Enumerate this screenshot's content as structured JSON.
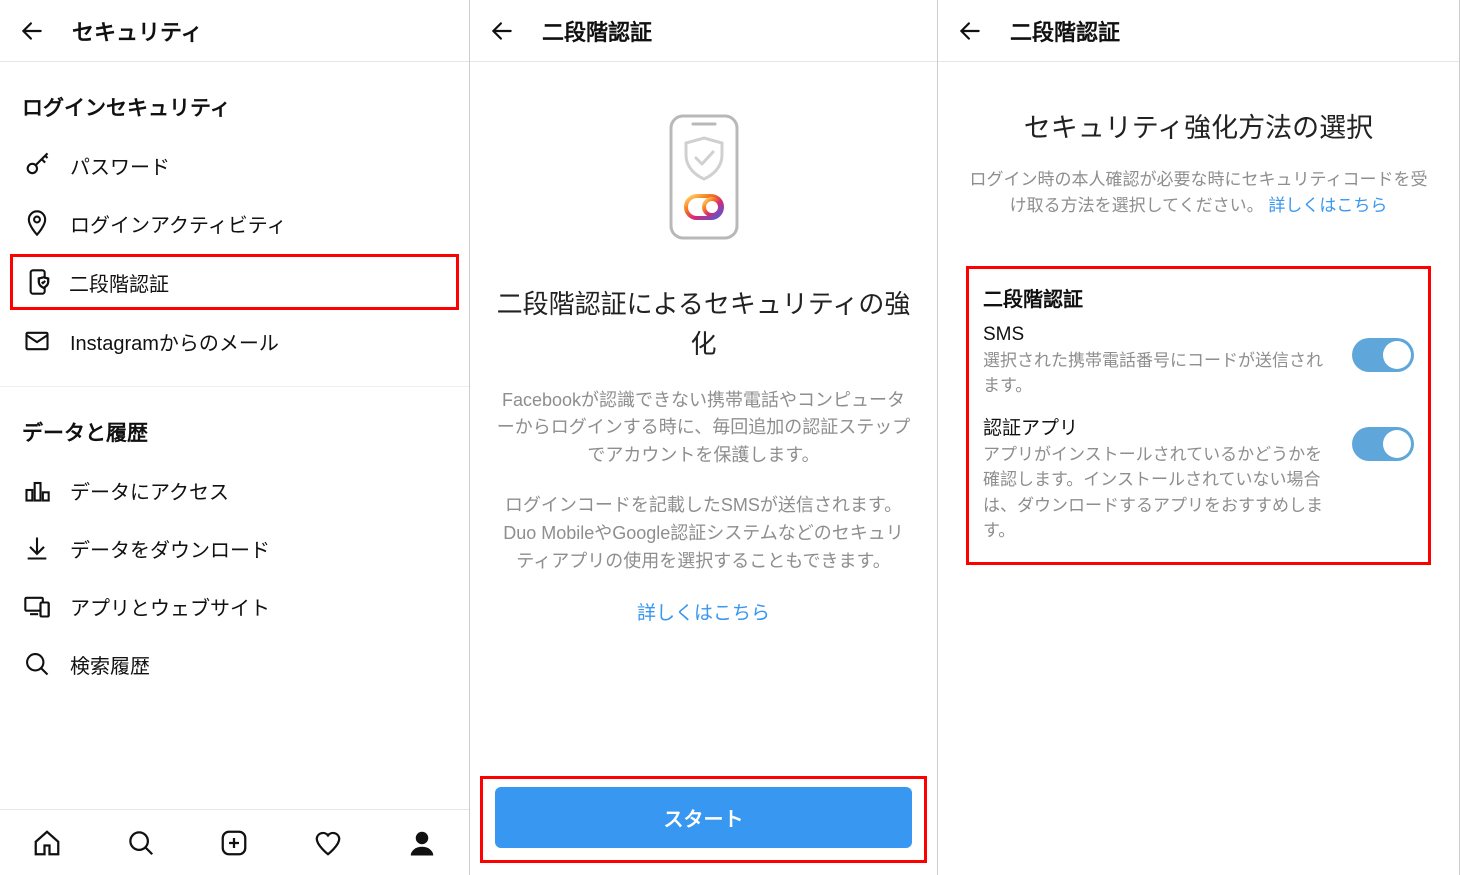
{
  "panel1": {
    "title": "セキュリティ",
    "section1_title": "ログインセキュリティ",
    "items1": [
      {
        "label": "パスワード"
      },
      {
        "label": "ログインアクティビティ"
      },
      {
        "label": "二段階認証"
      },
      {
        "label": "Instagramからのメール"
      }
    ],
    "section2_title": "データと履歴",
    "items2": [
      {
        "label": "データにアクセス"
      },
      {
        "label": "データをダウンロード"
      },
      {
        "label": "アプリとウェブサイト"
      },
      {
        "label": "検索履歴"
      }
    ]
  },
  "panel2": {
    "title": "二段階認証",
    "heading": "二段階認証によるセキュリティの強化",
    "para1": "Facebookが認識できない携帯電話やコンピューターからログインする時に、毎回追加の認証ステップでアカウントを保護します。",
    "para2": "ログインコードを記載したSMSが送信されます。Duo MobileやGoogle認証システムなどのセキュリティアプリの使用を選択することもできます。",
    "more_link": "詳しくはこちら",
    "start_button": "スタート"
  },
  "panel3": {
    "title": "二段階認証",
    "heading": "セキュリティ強化方法の選択",
    "sub_text": "ログイン時の本人確認が必要な時にセキュリティコードを受け取る方法を選択してください。",
    "more_link": "詳しくはこちら",
    "box_title": "二段階認証",
    "toggles": [
      {
        "label": "SMS",
        "desc": "選択された携帯電話番号にコードが送信されます。",
        "on": true
      },
      {
        "label": "認証アプリ",
        "desc": "アプリがインストールされているかどうかを確認します。インストールされていない場合は、ダウンロードするアプリをおすすめします。",
        "on": true
      }
    ]
  },
  "colors": {
    "accent": "#3897f0",
    "highlight": "#ff0000"
  }
}
